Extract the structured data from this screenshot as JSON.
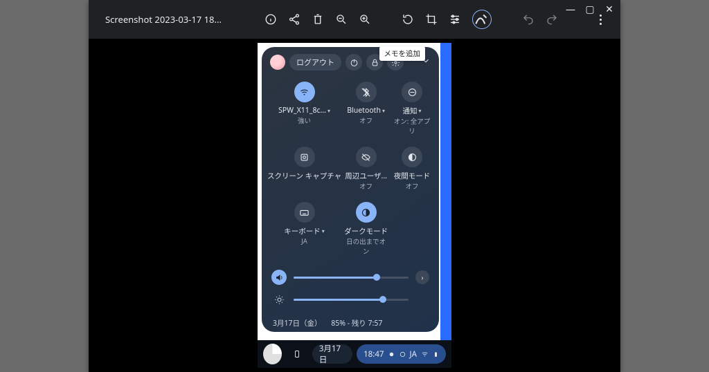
{
  "window": {
    "title": "Screenshot 2023-03-17 18...",
    "controls": {
      "min": "—",
      "max": "▢",
      "close": "✕"
    }
  },
  "toolbar_tooltip": "メモを追加",
  "panel": {
    "logout": "ログアウト",
    "tiles": [
      {
        "label": "SPW_X11_8c...",
        "sub": "強い",
        "has_arrow": true,
        "on": true
      },
      {
        "label": "Bluetooth",
        "sub": "オフ",
        "has_arrow": true,
        "on": false
      },
      {
        "label": "通知",
        "sub": "オン: 全アプリ",
        "has_arrow": true,
        "on": false
      },
      {
        "label": "スクリーン キャプチャ",
        "sub": "",
        "has_arrow": false,
        "on": false
      },
      {
        "label": "周辺ユーザ...",
        "sub": "オフ",
        "has_arrow": false,
        "on": false
      },
      {
        "label": "夜間モード",
        "sub": "オフ",
        "has_arrow": false,
        "on": false
      },
      {
        "label": "キーボード",
        "sub": "JA",
        "has_arrow": true,
        "on": false
      },
      {
        "label": "ダークモード",
        "sub": "日の出までオン",
        "has_arrow": false,
        "on": true
      }
    ],
    "sliders": {
      "volume_pct": 72,
      "brightness_pct": 78
    },
    "footer": {
      "date": "3月17日（金）",
      "battery": "85% ‑ 残り 7:57"
    }
  },
  "taskbar": {
    "date": "3月17日",
    "time": "18:47",
    "ime": "JA"
  }
}
